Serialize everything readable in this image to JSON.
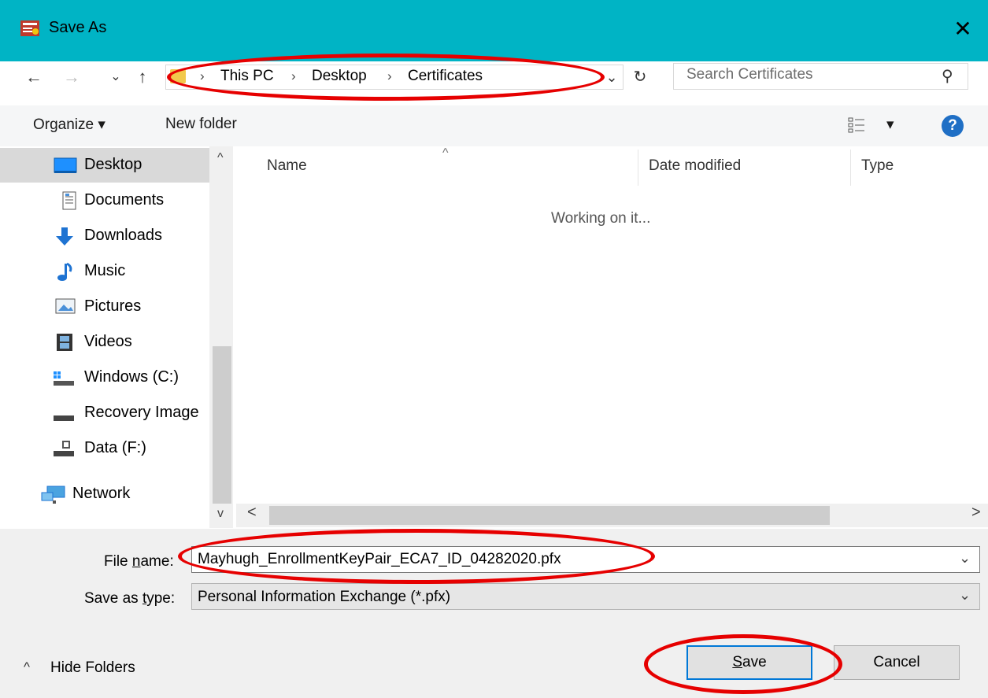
{
  "window": {
    "title": "Save As",
    "close_glyph": "✕",
    "app_icon": "certificate-export-icon"
  },
  "nav": {
    "back_glyph": "←",
    "forward_glyph": "→",
    "recent_glyph": "⌄",
    "up_glyph": "↑",
    "breadcrumb": [
      "This PC",
      "Desktop",
      "Certificates"
    ],
    "separator": "›",
    "dropdown_glyph": "⌄",
    "refresh_glyph": "↻",
    "search_placeholder": "Search Certificates",
    "search_glyph": "⚲"
  },
  "commands": {
    "organize": "Organize ▾",
    "new_folder": "New folder",
    "view_glyph": "▾",
    "help_glyph": "?"
  },
  "sidebar": {
    "items": [
      {
        "label": "Desktop",
        "icon": "desktop-icon",
        "selected": true
      },
      {
        "label": "Documents",
        "icon": "documents-icon"
      },
      {
        "label": "Downloads",
        "icon": "downloads-icon"
      },
      {
        "label": "Music",
        "icon": "music-icon"
      },
      {
        "label": "Pictures",
        "icon": "pictures-icon"
      },
      {
        "label": "Videos",
        "icon": "videos-icon"
      },
      {
        "label": "Windows (C:)",
        "icon": "drive-icon"
      },
      {
        "label": "Recovery Image",
        "icon": "drive-icon"
      },
      {
        "label": "Data (F:)",
        "icon": "drive-icon"
      },
      {
        "label": "Network",
        "icon": "network-icon"
      }
    ],
    "scroll_up": "^",
    "scroll_down": "v"
  },
  "filelist": {
    "columns": [
      "Name",
      "Date modified",
      "Type"
    ],
    "sort_glyph": "^",
    "status": "Working on it..."
  },
  "hscroll": {
    "left_glyph": "<",
    "right_glyph": ">"
  },
  "form": {
    "filename_label_pre": "File ",
    "filename_label_u": "n",
    "filename_label_post": "ame:",
    "filename_value": "Mayhugh_EnrollmentKeyPair_ECA7_ID_04282020.pfx",
    "type_label_pre": "Save as ",
    "type_label_u": "t",
    "type_label_post": "ype:",
    "type_value": "Personal Information Exchange (*.pfx)",
    "combo_glyph": "⌄"
  },
  "footer": {
    "hide_folders": "Hide Folders",
    "hide_glyph": "^",
    "save_u": "S",
    "save_rest": "ave",
    "cancel": "Cancel"
  },
  "colors": {
    "titlebar": "#00b4c5",
    "highlight": "#e60000",
    "help": "#1f6fc5"
  }
}
